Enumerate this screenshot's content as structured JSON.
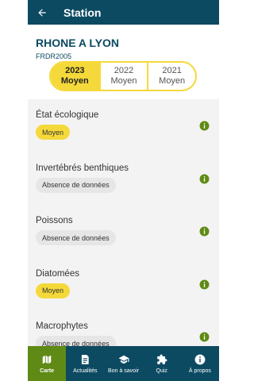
{
  "appbar": {
    "title": "Station"
  },
  "station": {
    "name": "RHONE A LYON",
    "code": "FRDR2005"
  },
  "years": [
    {
      "year": "2023",
      "status": "Moyen",
      "selected": true
    },
    {
      "year": "2022",
      "status": "Moyen",
      "selected": false
    },
    {
      "year": "2021",
      "status": "Moyen",
      "selected": false
    }
  ],
  "indicators": [
    {
      "title": "État écologique",
      "status": "Moyen",
      "color": "#f5d93a"
    },
    {
      "title": "Invertébrés benthiques",
      "status": "Absence de données",
      "color": "#e6e6e6"
    },
    {
      "title": "Poissons",
      "status": "Absence de données",
      "color": "#e6e6e6"
    },
    {
      "title": "Diatomées",
      "status": "Moyen",
      "color": "#f5d93a"
    },
    {
      "title": "Macrophytes",
      "status": "Absence de données",
      "color": "#e6e6e6"
    }
  ],
  "nav": [
    {
      "label": "Carte",
      "icon": "map-icon",
      "active": true
    },
    {
      "label": "Actualités",
      "icon": "news-icon",
      "active": false
    },
    {
      "label": "Bon à savoir",
      "icon": "graduation-cap-icon",
      "active": false
    },
    {
      "label": "Quiz",
      "icon": "puzzle-icon",
      "active": false
    },
    {
      "label": "À propos",
      "icon": "info-icon",
      "active": false
    }
  ],
  "colors": {
    "primary": "#0c4a62",
    "accent": "#f5d93a",
    "nav_active": "#5f8a16",
    "info_icon": "#5f8a16"
  }
}
